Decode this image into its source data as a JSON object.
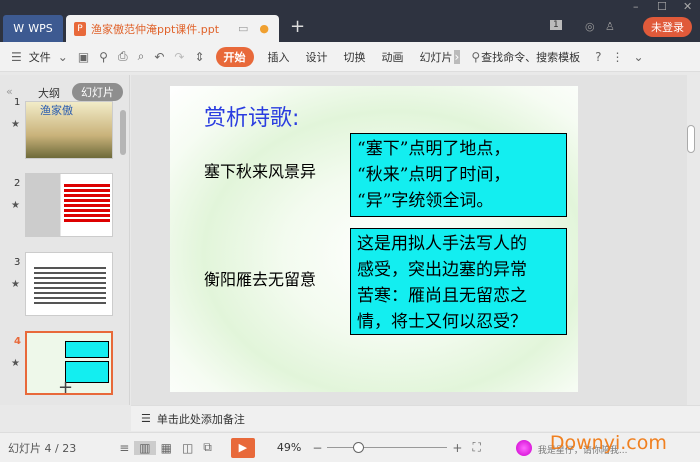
{
  "titlebar": {
    "app_tab": "WPS",
    "doc_tab": "渔家傲范仲淹ppt课件.ppt",
    "new_tab": "+",
    "badge_num": "1",
    "login": "未登录"
  },
  "toolbar": {
    "menu": "文件",
    "tabs": [
      "开始",
      "插入",
      "设计",
      "切换",
      "动画",
      "幻灯片"
    ],
    "search": "查找命令、搜索模板",
    "help": "?"
  },
  "left_panel": {
    "tab_outline": "大纲",
    "tab_slides": "幻灯片",
    "slides": [
      {
        "num": "1",
        "title": "渔家傲"
      },
      {
        "num": "2"
      },
      {
        "num": "3"
      },
      {
        "num": "4"
      }
    ],
    "add": "+"
  },
  "slide": {
    "title": "赏析诗歌:",
    "line1": "塞下秋来风景异",
    "box1": [
      "“塞下”点明了地点，",
      "“秋来”点明了时间，",
      "“异”字统领全词。"
    ],
    "line2": "衡阳雁去无留意",
    "box2": [
      "这是用拟人手法写人的",
      "感受，突出边塞的异常",
      "苦寒：雁尚且无留恋之",
      "情，将士又何以忍受？"
    ]
  },
  "notes": {
    "placeholder": "单击此处添加备注"
  },
  "status": {
    "slide_counter": "幻灯片 4 / 23",
    "zoom": "49%",
    "zoom_fraction": 0.3,
    "watermark": "Downyi.com",
    "blurb": "我是星仔，请你陪我..."
  },
  "colors": {
    "accent": "#e8693a",
    "title_blue": "#2a3de0",
    "box_cyan": "#13eef0"
  }
}
